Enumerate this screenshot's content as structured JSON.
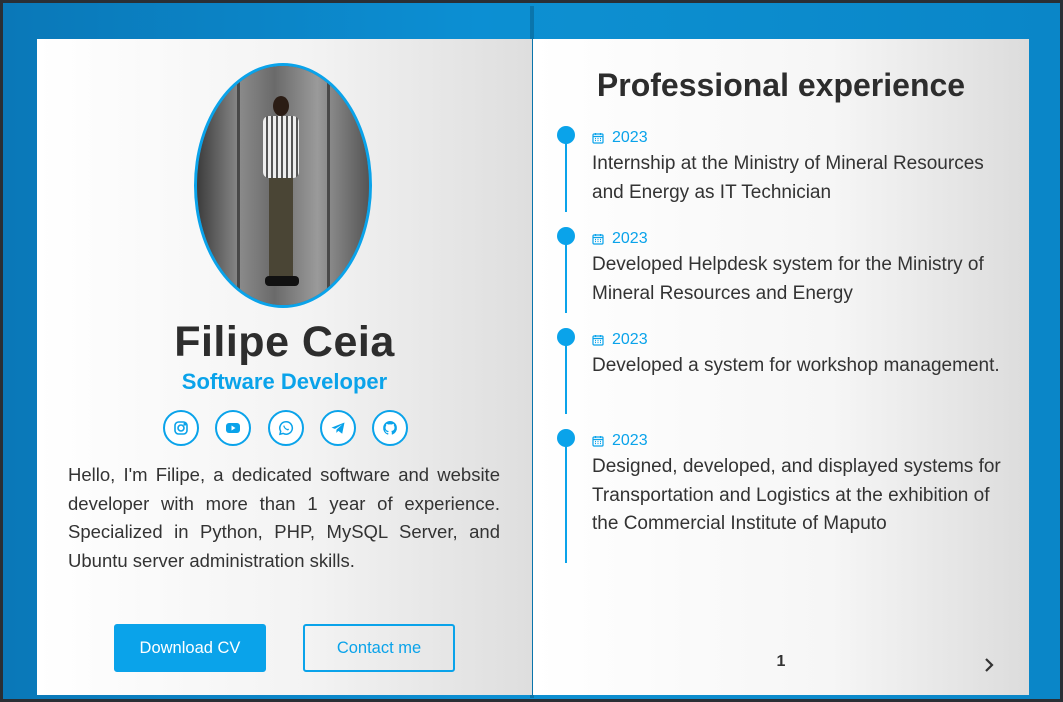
{
  "profile": {
    "name": "Filipe Ceia",
    "role": "Software Developer",
    "bio": "Hello, I'm Filipe, a dedicated software and website developer with more than 1 year of experience. Specialized in Python, PHP, MySQL Server, and Ubuntu server administration skills.",
    "socials": [
      {
        "icon": "instagram-icon"
      },
      {
        "icon": "youtube-icon"
      },
      {
        "icon": "whatsapp-icon"
      },
      {
        "icon": "telegram-icon"
      },
      {
        "icon": "github-icon"
      }
    ],
    "buttons": {
      "download_cv": "Download CV",
      "contact": "Contact me"
    }
  },
  "experience": {
    "title": "Professional experience",
    "items": [
      {
        "year": "2023",
        "description": "Internship at the Ministry of Mineral Resources and Energy as IT Technician"
      },
      {
        "year": "2023",
        "description": "Developed Helpdesk system for the Ministry of Mineral Resources and Energy"
      },
      {
        "year": "2023",
        "description": "Developed a system for workshop management."
      },
      {
        "year": "2023",
        "description": "Designed, developed, and displayed systems for Transportation and Logistics at the exhibition of the Commercial Institute of Maputo"
      }
    ]
  },
  "pagination": {
    "current_page": "1",
    "next_icon": "chevron-right-icon"
  },
  "colors": {
    "accent": "#0aa3ea",
    "background": "#0c8fd3",
    "text": "#333333"
  }
}
